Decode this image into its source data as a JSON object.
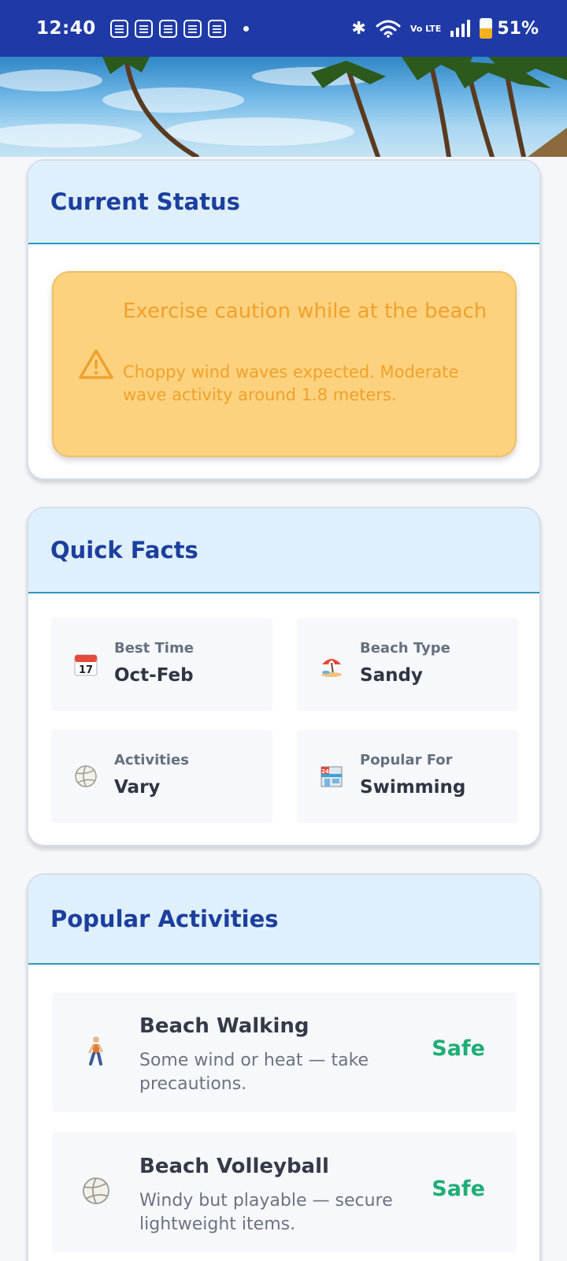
{
  "status_bar": {
    "time": "12:40",
    "notification_icons": [
      "app-notification-icon",
      "app-notification-icon",
      "app-notification-icon",
      "app-notification-icon",
      "app-notification-icon"
    ],
    "network_label": "Vo LTE",
    "battery_text": "51%",
    "battery_level": 0.51,
    "colors": {
      "background": "#1f3aa6",
      "battery_fill": "#f2b01e"
    }
  },
  "hero": {
    "image": "beach-palm-trees-image"
  },
  "current_status": {
    "title": "Current Status",
    "alert": {
      "icon": "warning-triangle-icon",
      "title": "Exercise caution while at the beach",
      "message": "Choppy wind waves expected. Moderate wave activity around 1.8 meters.",
      "color": "#f0a12c",
      "background": "#fdd27e"
    }
  },
  "quick_facts": {
    "title": "Quick Facts",
    "items": [
      {
        "icon": "calendar-icon",
        "label": "Best Time",
        "value": "Oct-Feb"
      },
      {
        "icon": "beach-umbrella-icon",
        "label": "Beach Type",
        "value": "Sandy"
      },
      {
        "icon": "volleyball-icon",
        "label": "Activities",
        "value": "Vary"
      },
      {
        "icon": "store-icon",
        "label": "Popular For",
        "value": "Swimming"
      }
    ]
  },
  "popular_activities": {
    "title": "Popular Activities",
    "items": [
      {
        "icon": "walking-person-icon",
        "name": "Beach Walking",
        "description": "Some wind or heat — take precautions.",
        "status": "Safe"
      },
      {
        "icon": "volleyball-icon",
        "name": "Beach Volleyball",
        "description": "Windy but playable — secure lightweight items.",
        "status": "Safe"
      }
    ],
    "status_color": "#1fae75"
  },
  "theme": {
    "heading": "#1c3f9e",
    "card_header_bg": "#dff0fc",
    "divider": "#2d97b8"
  }
}
